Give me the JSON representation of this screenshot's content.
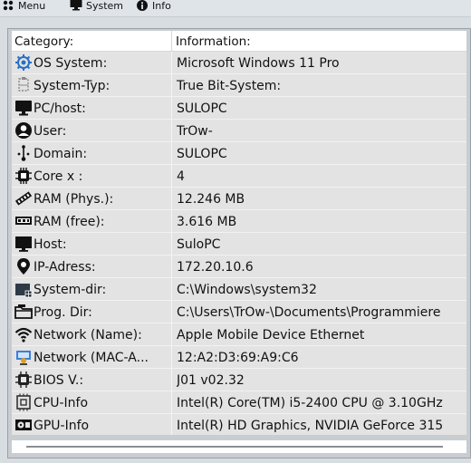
{
  "toolbar": {
    "menu_label": "Menu",
    "system_label": "System",
    "info_label": "Info"
  },
  "table": {
    "header_category": "Category:",
    "header_information": "Information:",
    "rows": [
      {
        "icon": "os-system-icon",
        "category": "OS System:",
        "value": "Microsoft Windows 11 Pro"
      },
      {
        "icon": "system-type-icon",
        "category": "System-Typ:",
        "value": "True Bit-System:"
      },
      {
        "icon": "monitor-icon",
        "category": "PC/host:",
        "value": "SULOPC"
      },
      {
        "icon": "user-icon",
        "category": "User:",
        "value": "TrOw-"
      },
      {
        "icon": "domain-icon",
        "category": "Domain:",
        "value": "SULOPC"
      },
      {
        "icon": "cpu-chip-icon",
        "category": "Core x :",
        "value": "4"
      },
      {
        "icon": "ram-icon",
        "category": "RAM (Phys.):",
        "value": "12.246 MB"
      },
      {
        "icon": "ram-free-icon",
        "category": "RAM (free):",
        "value": "3.616 MB"
      },
      {
        "icon": "host-monitor-icon",
        "category": "Host:",
        "value": "SuloPC"
      },
      {
        "icon": "location-pin-icon",
        "category": "IP-Adress:",
        "value": "172.20.10.6"
      },
      {
        "icon": "system-dir-icon",
        "category": "System-dir:",
        "value": "C:\\Windows\\system32"
      },
      {
        "icon": "folder-icon",
        "category": "Prog. Dir:",
        "value": "C:\\Users\\TrOw-\\Documents\\Programmiere"
      },
      {
        "icon": "wifi-icon",
        "category": "Network (Name):",
        "value": "Apple Mobile Device Ethernet"
      },
      {
        "icon": "network-icon",
        "category": "Network (MAC-A...",
        "value": "12:A2:D3:69:A9:C6"
      },
      {
        "icon": "bios-chip-icon",
        "category": "BIOS V.:",
        "value": "J01 v02.32"
      },
      {
        "icon": "cpu-icon",
        "category": "CPU-Info",
        "value": "Intel(R) Core(TM) i5-2400 CPU @ 3.10GHz"
      },
      {
        "icon": "gpu-icon",
        "category": "GPU-Info",
        "value": "Intel(R) HD Graphics, NVIDIA GeForce 315"
      }
    ]
  }
}
